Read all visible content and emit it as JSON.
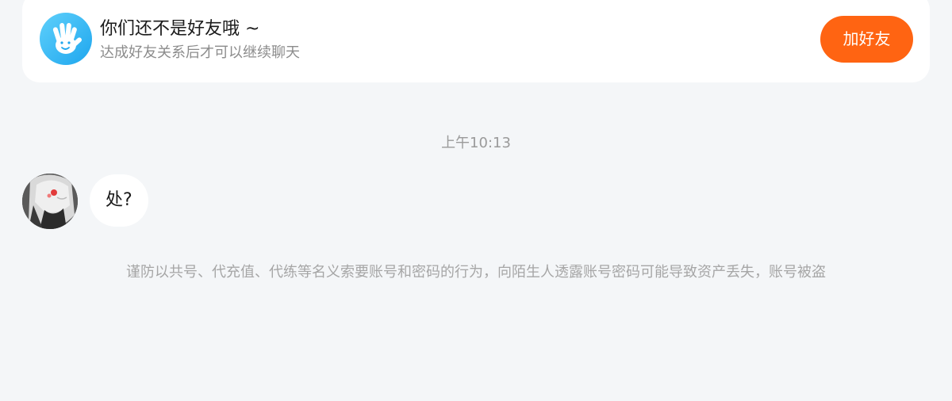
{
  "banner": {
    "icon": "waving-hand-icon",
    "title": "你们还不是好友哦 ~",
    "subtitle": "达成好友关系后才可以继续聊天",
    "add_friend_label": "加好友",
    "accent_color": "#ff6412",
    "icon_color": "#1ea6ee"
  },
  "chat": {
    "timestamp": "上午10:13",
    "messages": [
      {
        "sender": "contact",
        "text": "处?"
      }
    ]
  },
  "notice": {
    "text": "谨防以共号、代充值、代练等名义索要账号和密码的行为，向陌生人透露账号密码可能导致资产丢失，账号被盗"
  }
}
